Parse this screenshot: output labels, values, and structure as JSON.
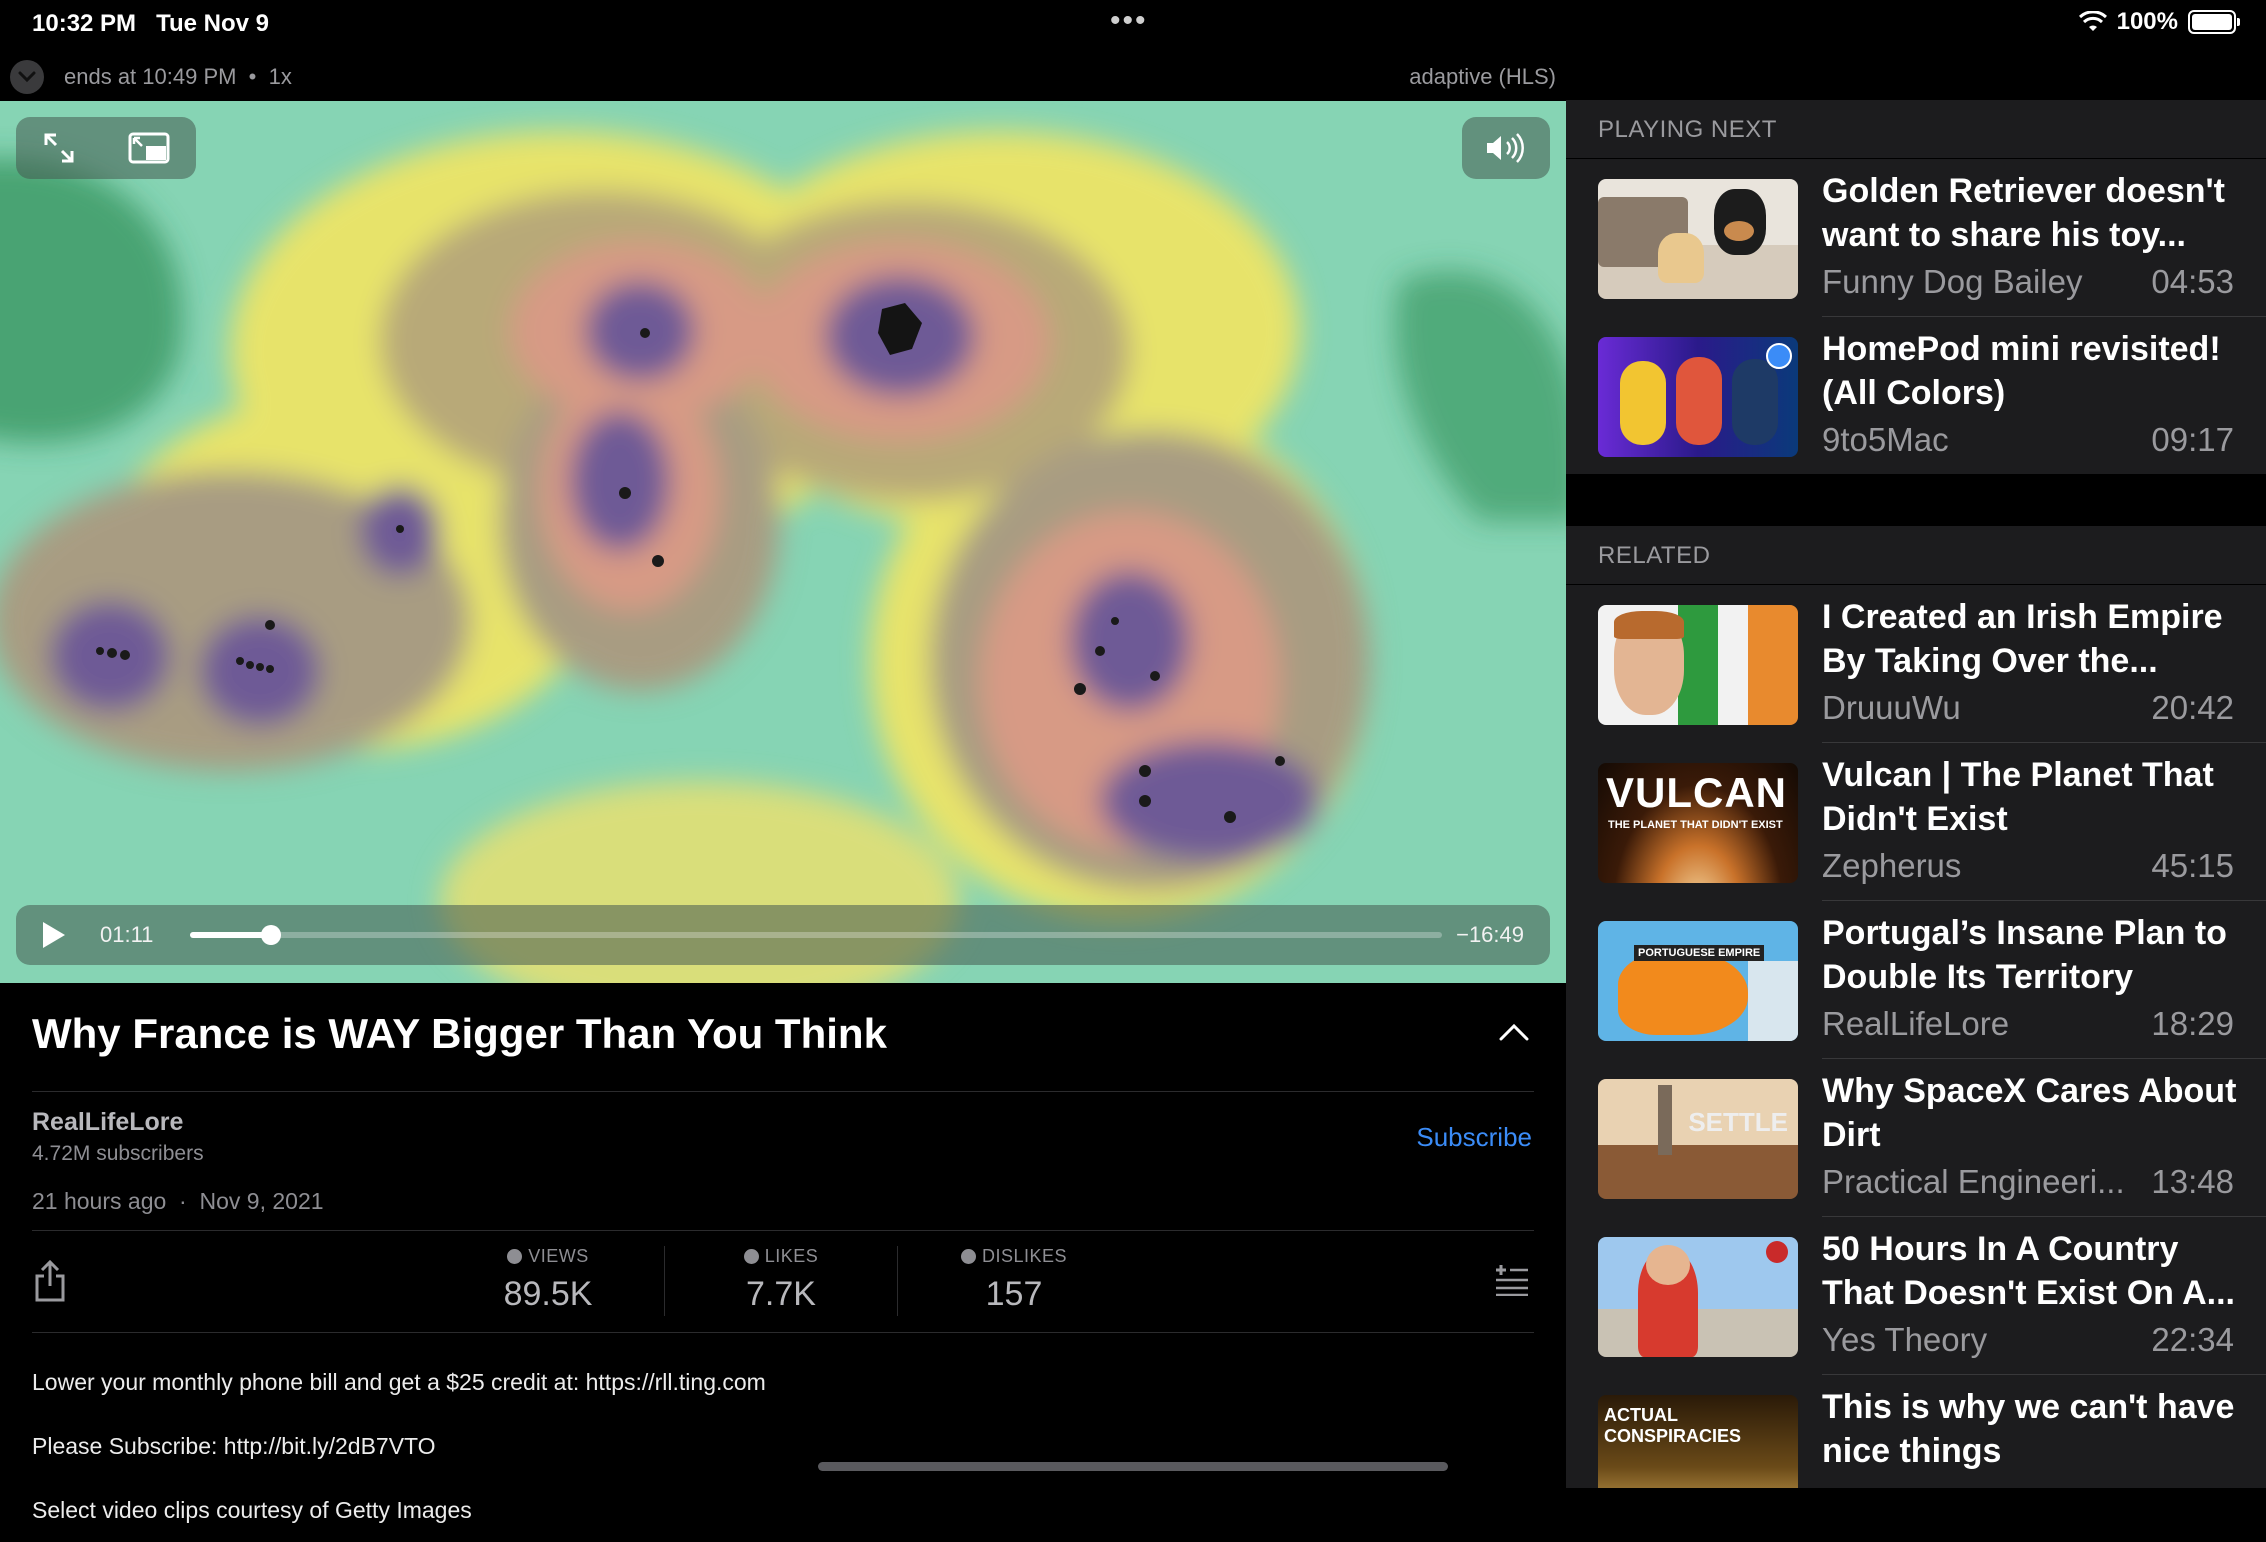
{
  "status_bar": {
    "time": "10:32 PM",
    "date": "Tue Nov 9",
    "battery": "100%"
  },
  "player": {
    "ends_at": "ends at 10:49 PM",
    "speed": "1x",
    "quality": "adaptive (HLS)",
    "current_time": "01:11",
    "remaining_time": "−16:49",
    "progress_fraction": 0.0645
  },
  "video": {
    "title": "Why France is WAY Bigger Than You Think",
    "channel": "RealLifeLore",
    "subscribers": "4.72M subscribers",
    "subscribe_label": "Subscribe",
    "posted_relative": "21 hours ago",
    "posted_date": "Nov 9, 2021",
    "stats": [
      {
        "label": "VIEWS",
        "value": "89.5K",
        "icon": "eye-icon"
      },
      {
        "label": "LIKES",
        "value": "7.7K",
        "icon": "thumbs-up-icon"
      },
      {
        "label": "DISLIKES",
        "value": "157",
        "icon": "thumbs-down-icon"
      }
    ],
    "description_lines": [
      "Lower your monthly phone bill and get a $25 credit at: https://rll.ting.com",
      "Please Subscribe: http://bit.ly/2dB7VTO",
      "Select video clips courtesy of Getty Images"
    ]
  },
  "playing_next": {
    "heading": "PLAYING NEXT",
    "items": [
      {
        "title": "Golden Retriever doesn't want to share his toy...",
        "channel": "Funny Dog Bailey",
        "duration": "04:53"
      },
      {
        "title": "HomePod mini revisited! (All Colors)",
        "channel": "9to5Mac",
        "duration": "09:17"
      }
    ]
  },
  "related": {
    "heading": "RELATED",
    "items": [
      {
        "title": "I Created an Irish Empire By Taking Over the...",
        "channel": "DruuuWu",
        "duration": "20:42"
      },
      {
        "title": "Vulcan | The Planet That Didn't Exist",
        "channel": "Zepherus",
        "duration": "45:15",
        "thumb_text": "VULCAN",
        "thumb_sub": "THE PLANET THAT DIDN'T EXIST"
      },
      {
        "title": "Portugal’s Insane Plan to Double Its Territory",
        "channel": "RealLifeLore",
        "duration": "18:29",
        "thumb_text": "PORTUGUESE EMPIRE"
      },
      {
        "title": "Why SpaceX Cares About Dirt",
        "channel": "Practical Engineeri...",
        "duration": "13:48",
        "thumb_text": "SETTLE"
      },
      {
        "title": "50 Hours In A Country That Doesn't Exist On A...",
        "channel": "Yes Theory",
        "duration": "22:34"
      },
      {
        "title": "This is why we can't have nice things",
        "channel": "",
        "duration": "",
        "thumb_text": "ACTUAL CONSPIRACIES"
      }
    ]
  }
}
